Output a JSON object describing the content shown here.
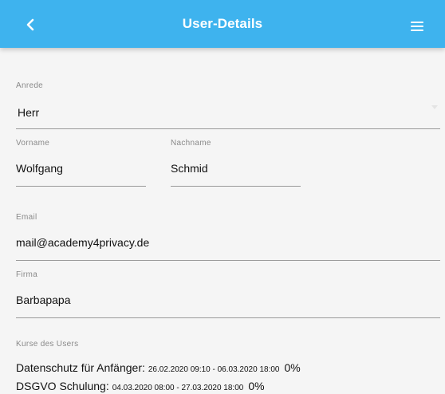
{
  "header": {
    "title": "User-Details",
    "color": "#3eb3ee"
  },
  "form": {
    "anrede": {
      "label": "Anrede",
      "value": "Herr"
    },
    "vorname": {
      "label": "Vorname",
      "value": "Wolfgang"
    },
    "nachname": {
      "label": "Nachname",
      "value": "Schmid"
    },
    "email": {
      "label": "Email",
      "value": "mail@academy4privacy.de"
    },
    "firma": {
      "label": "Firma",
      "value": "Barbapapa"
    }
  },
  "courses": {
    "label": "Kurse des Users",
    "items": [
      {
        "name": "Datenschutz für Anfänger:",
        "dates": "26.02.2020 09:10 - 06.03.2020 18:00",
        "progress": "0%"
      },
      {
        "name": "DSGVO Schulung:",
        "dates": "04.03.2020 08:00 - 27.03.2020 18:00",
        "progress": "0%"
      }
    ]
  },
  "icons": {
    "back": "chevron-left-icon",
    "menu": "hamburger-menu-icon"
  }
}
